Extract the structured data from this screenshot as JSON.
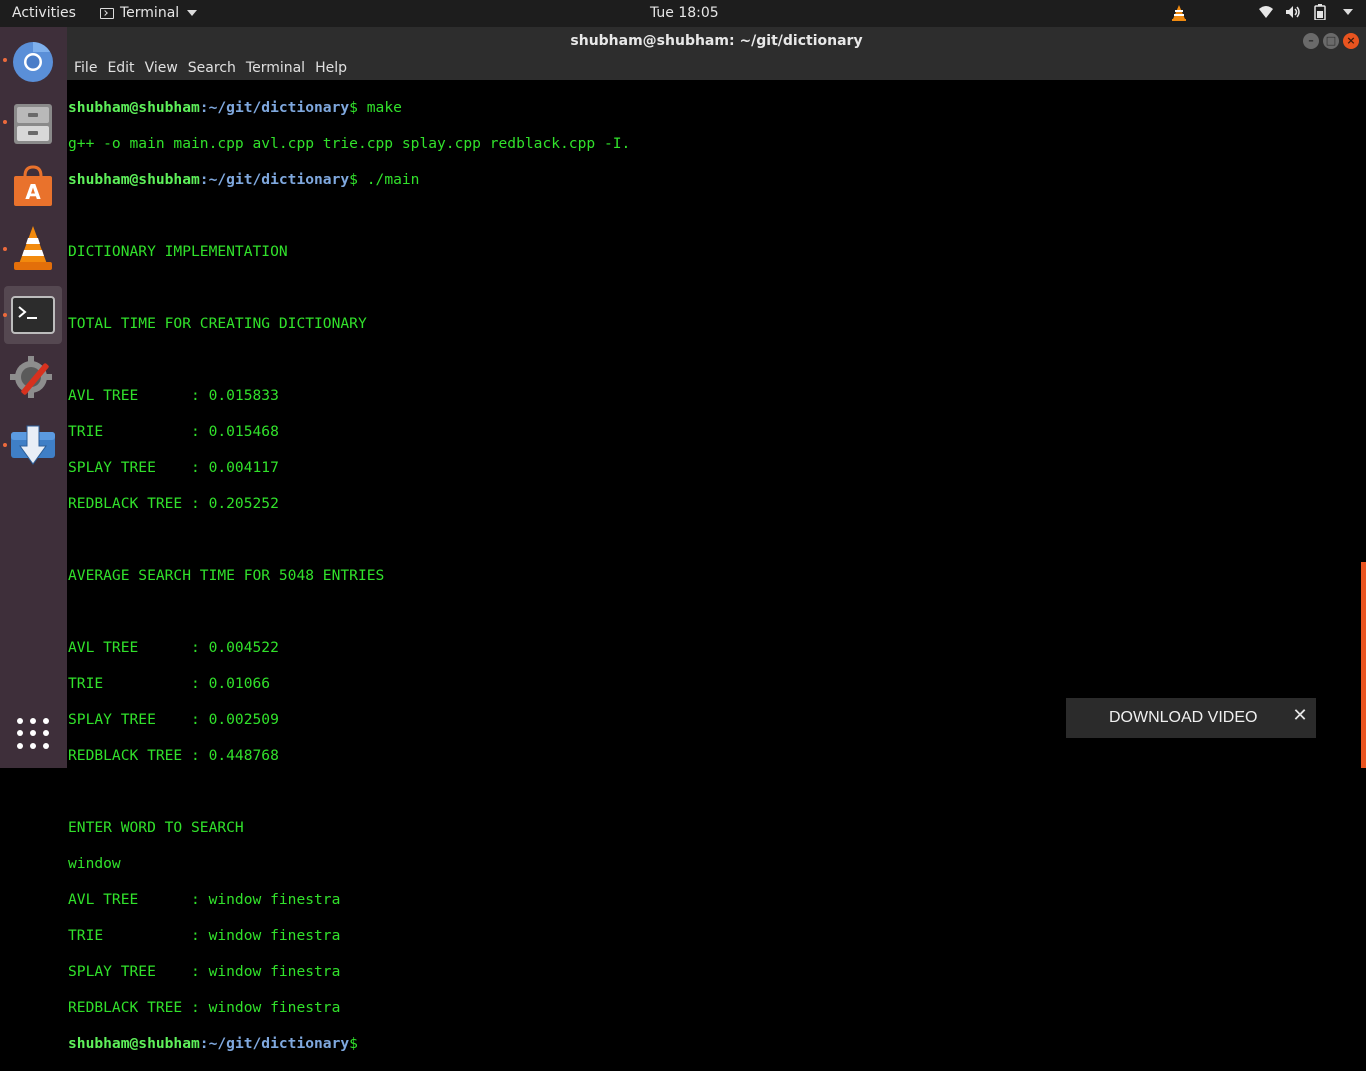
{
  "topbar": {
    "activities": "Activities",
    "app_name": "Terminal",
    "clock": "Tue 18:05",
    "tray_icons": [
      "vlc-cone-icon",
      "wifi-icon",
      "volume-icon",
      "battery-icon",
      "chevron-down-icon"
    ]
  },
  "dock": {
    "items": [
      {
        "name": "chromium-browser",
        "icon": "chromium-icon",
        "running": true
      },
      {
        "name": "files",
        "icon": "file-cabinet-icon",
        "running": true
      },
      {
        "name": "software-center",
        "icon": "shopping-bag-icon",
        "running": false
      },
      {
        "name": "vlc-media-player",
        "icon": "vlc-cone-icon",
        "running": true
      },
      {
        "name": "terminal",
        "icon": "terminal-icon",
        "running": true,
        "active": true
      },
      {
        "name": "system-settings",
        "icon": "gear-wrench-icon",
        "running": false
      },
      {
        "name": "downloader",
        "icon": "download-arrow-icon",
        "running": true
      }
    ],
    "show_apps_icon": "grid-icon"
  },
  "window": {
    "title": "shubham@shubham: ~/git/dictionary",
    "menu": [
      "File",
      "Edit",
      "View",
      "Search",
      "Terminal",
      "Help"
    ]
  },
  "terminal": {
    "prompt_user": "shubham@shubham",
    "prompt_path": ":~/git/dictionary",
    "prompt_symbol": "$ ",
    "cmd1": "make",
    "line_compile": "g++ -o main main.cpp avl.cpp trie.cpp splay.cpp redblack.cpp -I.",
    "cmd2": "./main",
    "line_header": "DICTIONARY IMPLEMENTATION",
    "line_total": "TOTAL TIME FOR CREATING DICTIONARY",
    "create_avl": "AVL TREE      : 0.015833",
    "create_trie": "TRIE          : 0.015468",
    "create_splay": "SPLAY TREE    : 0.004117",
    "create_rb": "REDBLACK TREE : 0.205252",
    "line_avg": "AVERAGE SEARCH TIME FOR 5048 ENTRIES",
    "search_avl": "AVL TREE      : 0.004522",
    "search_trie": "TRIE          : 0.01066",
    "search_splay": "SPLAY TREE    : 0.002509",
    "search_rb": "REDBLACK TREE : 0.448768",
    "line_enter": "ENTER WORD TO SEARCH",
    "input_word": "window",
    "result_avl": "AVL TREE      : window finestra",
    "result_trie": "TRIE          : window finestra",
    "result_splay": "SPLAY TREE    : window finestra",
    "result_rb": "REDBLACK TREE : window finestra"
  },
  "popup": {
    "label": "DOWNLOAD VIDEO",
    "close_icon": "close-icon"
  },
  "colors": {
    "terminal_text": "#31e12b",
    "prompt_user": "#5ef05a",
    "prompt_path": "#7fa8de",
    "dock_bg": "#3e2f3a",
    "accent": "#e9541f"
  }
}
